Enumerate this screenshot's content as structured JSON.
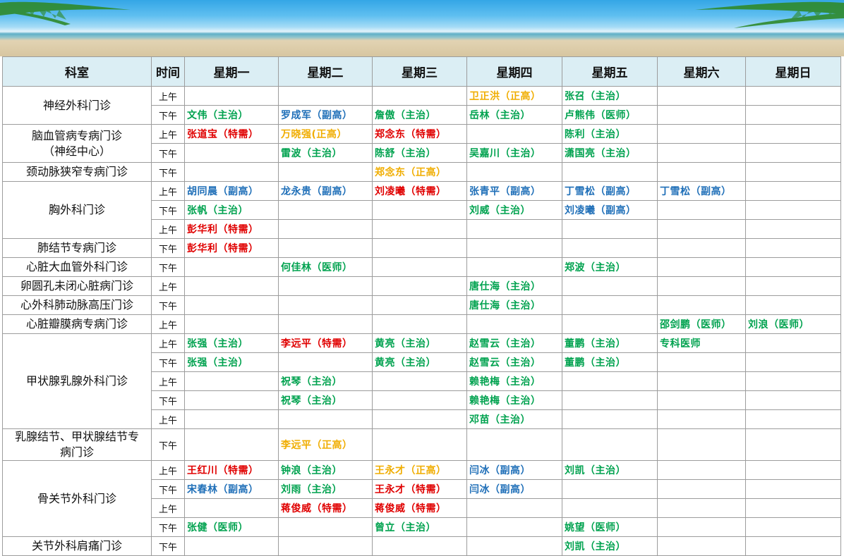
{
  "colors": {
    "red": "#e00000",
    "green": "#00a24f",
    "blue": "#1f6fb8",
    "orange": "#f0ad00",
    "header_bg": "#dbeef4"
  },
  "banner": {
    "icon": "beach-banner"
  },
  "headers": [
    "科室",
    "时间",
    "星期一",
    "星期二",
    "星期三",
    "星期四",
    "星期五",
    "星期六",
    "星期日"
  ],
  "rows": [
    {
      "dept": "神经外科门诊",
      "span": 2,
      "h": 27,
      "time": "上午",
      "cells": [
        null,
        null,
        null,
        {
          "t": "卫正洪（正高）",
          "c": "orange"
        },
        {
          "t": "张召（主治）",
          "c": "green"
        },
        null,
        null
      ]
    },
    {
      "time": "下午",
      "h": 27,
      "cells": [
        {
          "t": "文伟（主治）",
          "c": "green"
        },
        {
          "t": "罗成军（副高）",
          "c": "blue"
        },
        {
          "t": "詹傲（主治）",
          "c": "green"
        },
        {
          "t": "岳林（主治）",
          "c": "green"
        },
        {
          "t": "卢熊伟（医师）",
          "c": "green"
        },
        null,
        null
      ]
    },
    {
      "dept": "脑血管病专病门诊\n（神经中心）",
      "span": 2,
      "h": 27,
      "time": "上午",
      "cells": [
        {
          "t": "张道宝（特需）",
          "c": "red"
        },
        {
          "t": "万晓强(正高）",
          "c": "orange"
        },
        {
          "t": "郑念东（特需）",
          "c": "red"
        },
        null,
        {
          "t": "陈利（主治）",
          "c": "green"
        },
        null,
        null
      ]
    },
    {
      "time": "下午",
      "h": 27,
      "cells": [
        null,
        {
          "t": "雷波（主治）",
          "c": "green"
        },
        {
          "t": "陈舒（主治）",
          "c": "green"
        },
        {
          "t": "吴嘉川（主治）",
          "c": "green"
        },
        {
          "t": "潇国亮（主治）",
          "c": "green"
        },
        null,
        null
      ]
    },
    {
      "dept": "颈动脉狭窄专病门诊",
      "span": 1,
      "h": 27,
      "time": "下午",
      "cells": [
        null,
        null,
        {
          "t": "郑念东（正高）",
          "c": "orange"
        },
        null,
        null,
        null,
        null
      ]
    },
    {
      "dept": "胸外科门诊",
      "span": 3,
      "h": 27,
      "time": "上午",
      "cells": [
        {
          "t": "胡同晨（副高）",
          "c": "blue"
        },
        {
          "t": "龙永贵（副高）",
          "c": "blue"
        },
        {
          "t": "刘凌曦（特需）",
          "c": "red"
        },
        {
          "t": "张青平（副高）",
          "c": "blue"
        },
        {
          "t": "丁雪松（副高）",
          "c": "blue"
        },
        {
          "t": "丁雪松（副高）",
          "c": "blue"
        },
        null
      ]
    },
    {
      "time": "下午",
      "h": 27,
      "cells": [
        {
          "t": "张帆（主治）",
          "c": "green"
        },
        null,
        null,
        {
          "t": "刘威（主治）",
          "c": "green"
        },
        {
          "t": "刘凌曦（副高）",
          "c": "blue"
        },
        null,
        null
      ]
    },
    {
      "time": "上午",
      "h": 27,
      "cells": [
        {
          "t": "彭华利（特需）",
          "c": "red"
        },
        null,
        null,
        null,
        null,
        null,
        null
      ]
    },
    {
      "dept": "肺结节专病门诊",
      "span": 1,
      "h": 27,
      "time": "下午",
      "cells": [
        {
          "t": "彭华利（特需）",
          "c": "red"
        },
        null,
        null,
        null,
        null,
        null,
        null
      ]
    },
    {
      "dept": "心脏大血管外科门诊",
      "span": 1,
      "h": 27,
      "time": "下午",
      "cells": [
        null,
        {
          "t": "何佳林（医师）",
          "c": "green"
        },
        null,
        null,
        {
          "t": "郑波（主治）",
          "c": "green"
        },
        null,
        null
      ]
    },
    {
      "dept": "卵圆孔未闭心脏病门诊",
      "span": 1,
      "h": 27,
      "time": "上午",
      "cells": [
        null,
        null,
        null,
        {
          "t": "唐仕海（主治）",
          "c": "green"
        },
        null,
        null,
        null
      ]
    },
    {
      "dept": "心外科肺动脉高压门诊",
      "span": 1,
      "h": 27,
      "time": "下午",
      "cells": [
        null,
        null,
        null,
        {
          "t": "唐仕海（主治）",
          "c": "green"
        },
        null,
        null,
        null
      ]
    },
    {
      "dept": "心脏瓣膜病专病门诊",
      "span": 1,
      "h": 27,
      "time": "上午",
      "cells": [
        null,
        null,
        null,
        null,
        null,
        {
          "t": "邵剑鹏（医师）",
          "c": "green"
        },
        {
          "t": "刘浪（医师）",
          "c": "green"
        }
      ]
    },
    {
      "dept": "甲状腺乳腺外科门诊",
      "span": 5,
      "h": 27,
      "time": "上午",
      "cells": [
        {
          "t": "张强（主治）",
          "c": "green"
        },
        {
          "t": "李远平（特需）",
          "c": "red"
        },
        {
          "t": "黄亮（主治）",
          "c": "green"
        },
        {
          "t": "赵雪云（主治）",
          "c": "green"
        },
        {
          "t": "董鹏（主治）",
          "c": "green"
        },
        {
          "t": "专科医师",
          "c": "green"
        },
        null
      ]
    },
    {
      "time": "下午",
      "h": 27,
      "cells": [
        {
          "t": "张强（主治）",
          "c": "green"
        },
        null,
        {
          "t": "黄亮（主治）",
          "c": "green"
        },
        {
          "t": "赵雪云（主治）",
          "c": "green"
        },
        {
          "t": "董鹏（主治）",
          "c": "green"
        },
        null,
        null
      ]
    },
    {
      "time": "上午",
      "h": 27,
      "cells": [
        null,
        {
          "t": "祝琴（主治）",
          "c": "green"
        },
        null,
        {
          "t": "赖艳梅（主治）",
          "c": "green"
        },
        null,
        null,
        null
      ]
    },
    {
      "time": "下午",
      "h": 27,
      "cells": [
        null,
        {
          "t": "祝琴（主治）",
          "c": "green"
        },
        null,
        {
          "t": "赖艳梅（主治）",
          "c": "green"
        },
        null,
        null,
        null
      ]
    },
    {
      "time": "上午",
      "h": 27,
      "cells": [
        null,
        null,
        null,
        {
          "t": "邓苗（主治）",
          "c": "green"
        },
        null,
        null,
        null
      ]
    },
    {
      "dept": "乳腺结节、甲状腺结节专\n病门诊",
      "span": 1,
      "h": 44,
      "time": "下午",
      "cells": [
        null,
        {
          "t": "李远平（正高）",
          "c": "orange"
        },
        null,
        null,
        null,
        null,
        null
      ]
    },
    {
      "dept": "骨关节外科门诊",
      "span": 4,
      "h": 27,
      "time": "上午",
      "cells": [
        {
          "t": "王红川（特需）",
          "c": "red"
        },
        {
          "t": "钟浪（主治）",
          "c": "green"
        },
        {
          "t": "王永才（正高）",
          "c": "orange"
        },
        {
          "t": "闫冰（副高）",
          "c": "blue"
        },
        {
          "t": "刘凯（主治）",
          "c": "green"
        },
        null,
        null
      ]
    },
    {
      "time": "下午",
      "h": 27,
      "cells": [
        {
          "t": "宋春林（副高）",
          "c": "blue"
        },
        {
          "t": "刘雨（主治）",
          "c": "green"
        },
        {
          "t": "王永才（特需）",
          "c": "red"
        },
        {
          "t": "闫冰（副高）",
          "c": "blue"
        },
        null,
        null,
        null
      ]
    },
    {
      "time": "上午",
      "h": 27,
      "cells": [
        null,
        {
          "t": "蒋俊威（特需）",
          "c": "red"
        },
        {
          "t": "蒋俊威（特需）",
          "c": "red"
        },
        null,
        null,
        null,
        null
      ]
    },
    {
      "time": "下午",
      "h": 27,
      "cells": [
        {
          "t": "张健（医师）",
          "c": "green"
        },
        null,
        {
          "t": "曾立（主治）",
          "c": "green"
        },
        null,
        {
          "t": "姚望（医师）",
          "c": "green"
        },
        null,
        null
      ]
    },
    {
      "dept": "关节外科肩痛门诊",
      "span": 1,
      "h": 27,
      "time": "下午",
      "cells": [
        null,
        null,
        null,
        null,
        {
          "t": "刘凯（主治）",
          "c": "green"
        },
        null,
        null
      ]
    }
  ]
}
